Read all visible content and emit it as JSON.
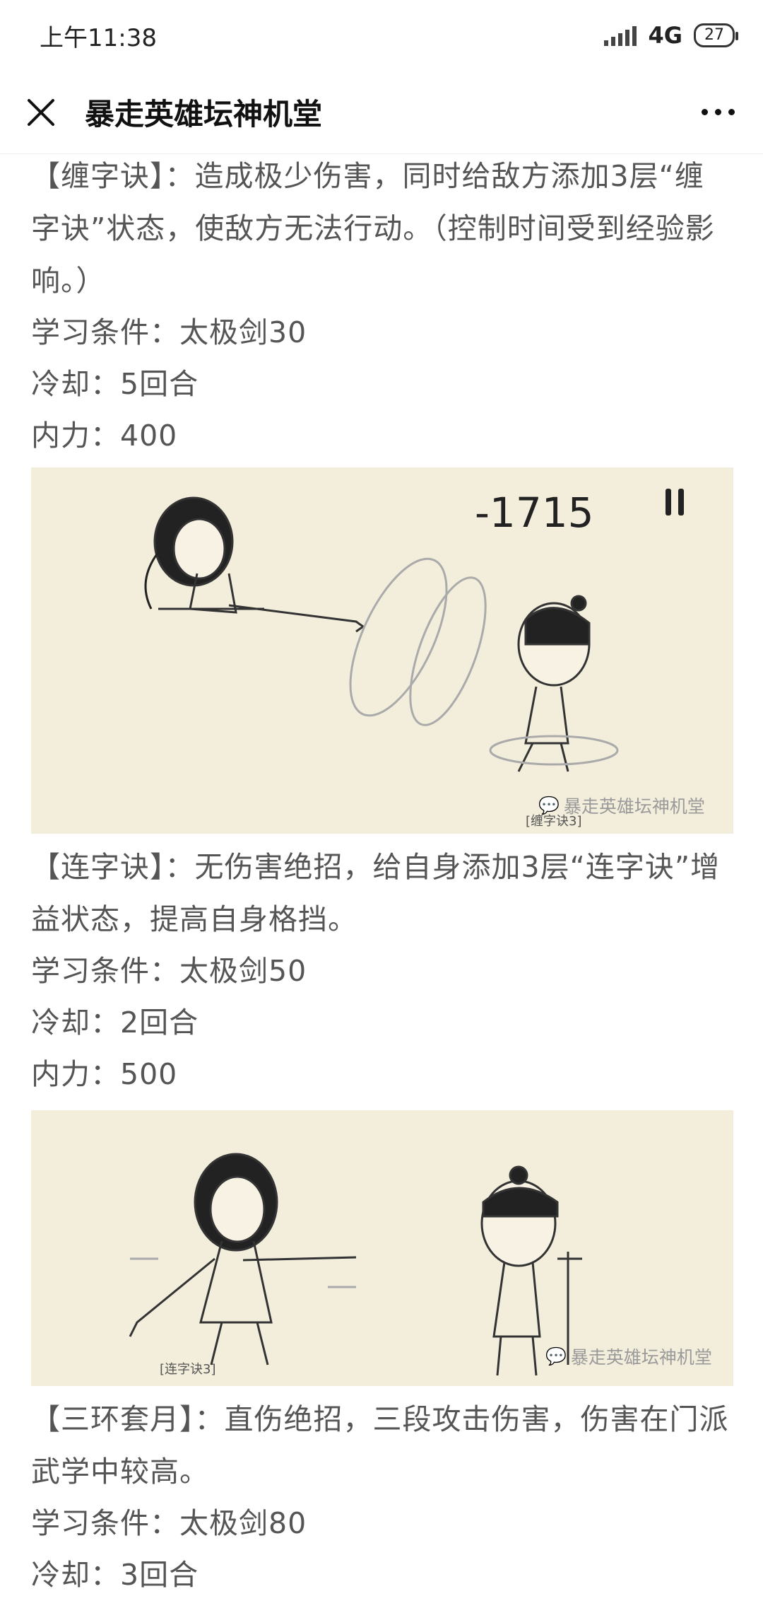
{
  "status_bar": {
    "time": "上午11:38",
    "network": "4G",
    "battery": "27"
  },
  "nav": {
    "title": "暴走英雄坛神机堂"
  },
  "skills": [
    {
      "desc": "【缠字诀】：造成极少伤害，同时给敌方添加3层“缠字诀”状态，使敌方无法行动。（控制时间受到经验影响。）",
      "req": "学习条件：太极剑30",
      "cooldown": "冷却：5回合",
      "mana": "内力：400"
    },
    {
      "desc": "【连字诀】：无伤害绝招，给自身添加3层“连字诀”增益状态，提高自身格挡。",
      "req": "学习条件：太极剑50",
      "cooldown": "冷却：2回合",
      "mana": "内力：500"
    },
    {
      "desc": "【三环套月】：直伤绝招，三段攻击伤害，伤害在门派武学中较高。",
      "req": "学习条件：太极剑80",
      "cooldown": "冷却：3回合"
    }
  ],
  "images": {
    "img1": {
      "damage": "-1715",
      "caption": "[缠字诀3]",
      "watermark": "暴走英雄坛神机堂"
    },
    "img2": {
      "caption": "[连字诀3]",
      "watermark": "暴走英雄坛神机堂"
    }
  },
  "colors": {
    "text": "#555555",
    "image_bg": "#f3eedb"
  }
}
